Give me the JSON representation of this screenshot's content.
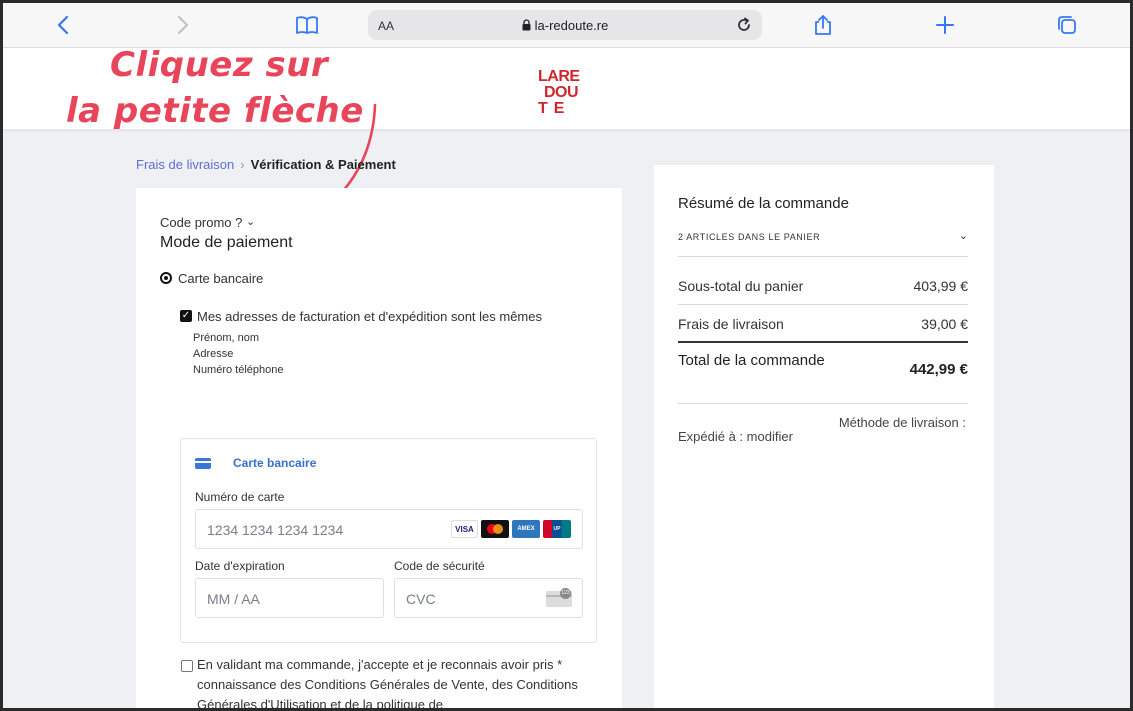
{
  "browser": {
    "text_size_label": "AA",
    "url": "la-redoute.re",
    "icons": [
      "back-icon",
      "forward-icon",
      "bookmarks-icon",
      "lock-icon",
      "reload-icon",
      "share-icon",
      "new-tab-icon",
      "tabs-icon"
    ]
  },
  "site": {
    "logo_lines": [
      "LARE",
      "DOU",
      "TE"
    ]
  },
  "annotation": {
    "line1": "Cliquez sur",
    "line2": "la petite flèche",
    "color": "#e8455a"
  },
  "breadcrumb": {
    "previous": "Frais de livraison",
    "separator": "›",
    "current": "Vérification & Paiement"
  },
  "payment": {
    "promo_label": "Code promo ?",
    "promo_chevron": "⌄",
    "section_title": "Mode de paiement",
    "method_label": "Carte bancaire",
    "same_address_label": "Mes adresses de facturation et d'expédition sont les mêmes",
    "address_lines": [
      "Prénom, nom",
      "Adresse",
      "Numéro téléphone"
    ],
    "card_form": {
      "title": "Carte bancaire",
      "card_number_label": "Numéro de carte",
      "card_number_placeholder": "1234 1234 1234 1234",
      "brands": [
        "VISA",
        "Mastercard",
        "American Express",
        "UnionPay"
      ],
      "expiry_label": "Date d'expiration",
      "expiry_placeholder": "MM / AA",
      "cvc_label": "Code de sécurité",
      "cvc_placeholder": "CVC"
    },
    "consent_text": "En validant ma commande, j'accepte et je reconnais avoir pris * connaissance des Conditions Générales de Vente, des Conditions Générales d'Utilisation et de la politique de"
  },
  "summary": {
    "title": "Résumé de la commande",
    "articles": "2 ARTICLES DANS LE PANIER",
    "chevron": "⌄",
    "subtotal_label": "Sous-total du panier",
    "subtotal_value": "403,99 €",
    "shipping_label": "Frais de livraison",
    "shipping_value": "39,00 €",
    "total_label": "Total de la commande",
    "total_value": "442,99 €",
    "delivery_method_label": "Méthode de livraison :",
    "shipped_to_label": "Expédié à : modifier"
  },
  "colors": {
    "accent": "#3a6fd0",
    "brand_red": "#d0272d",
    "annotation": "#e8455a"
  }
}
